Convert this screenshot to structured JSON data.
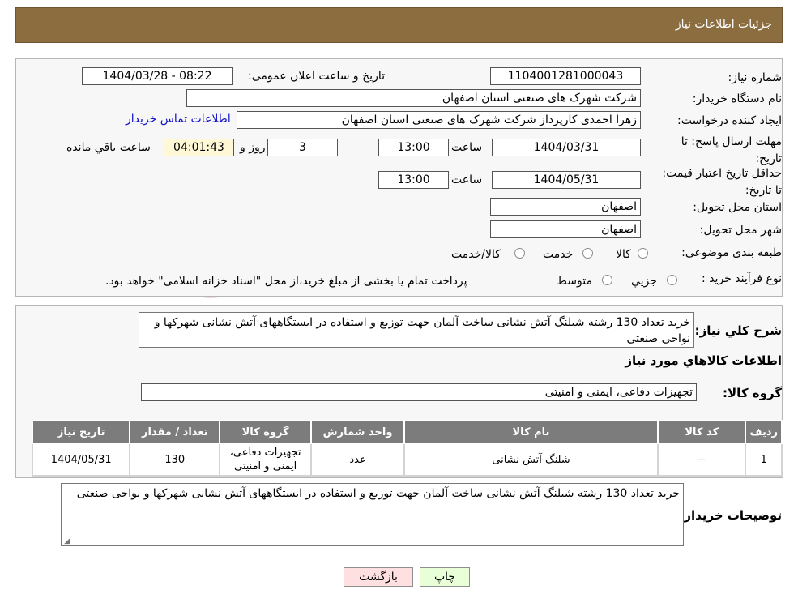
{
  "header": {
    "title": "جزئیات اطلاعات نیاز"
  },
  "form": {
    "need_number_label": "شماره نیاز:",
    "need_number": "1104001281000043",
    "announce_label": "تاریخ و ساعت اعلان عمومی:",
    "announce_value": "1404/03/28 - 08:22",
    "buyer_org_label": "نام دستگاه خریدار:",
    "buyer_org": "شرکت شهرک های صنعتی استان اصفهان",
    "creator_label": "ایجاد کننده درخواست:",
    "creator": "زهرا احمدی کارپرداز شرکت شهرک های صنعتی استان اصفهان",
    "contact_link": "اطلاعات تماس خریدار",
    "reply_deadline_label": "مهلت ارسال پاسخ: تا تاریخ:",
    "reply_date": "1404/03/31",
    "time_label": "ساعت",
    "reply_time": "13:00",
    "days": "3",
    "days_label": "روز و",
    "remaining_time": "04:01:43",
    "remaining_label": "ساعت باقي مانده",
    "validity_label": "حداقل تاریخ اعتبار قیمت: تا تاریخ:",
    "validity_date": "1404/05/31",
    "validity_time": "13:00",
    "province_label": "استان محل تحویل:",
    "province": "اصفهان",
    "city_label": "شهر محل تحویل:",
    "city": "اصفهان",
    "category_label": "طبقه بندی موضوعی:",
    "category_options": [
      "کالا",
      "خدمت",
      "کالا/خدمت"
    ],
    "process_label": "نوع فرآیند خرید :",
    "process_options": [
      "جزیي",
      "متوسط"
    ],
    "process_note": "پرداخت تمام یا بخشی از مبلغ خرید،از محل \"اسناد خزانه اسلامی\" خواهد بود."
  },
  "summary": {
    "label": "شرح کلي نياز:",
    "text": "خرید تعداد 130 رشته شیلنگ آتش نشانی ساخت آلمان جهت توزیع و استفاده در ایستگاههای آتش نشانی شهرکها و نواحی صنعتی",
    "goods_info_title": "اطلاعات کالاهاي مورد نياز",
    "goods_group_label": "گروه کالا:",
    "goods_group": "تجهیزات دفاعی، ایمنی و امنیتی"
  },
  "table": {
    "headers": [
      "رديف",
      "کد کالا",
      "نام کالا",
      "واحد شمارش",
      "گروه کالا",
      "تعداد / مقدار",
      "تاريخ نياز"
    ],
    "rows": [
      [
        "1",
        "--",
        "شلنگ آتش نشانی",
        "عدد",
        "تجهیزات دفاعی، ایمنی و امنیتی",
        "130",
        "1404/05/31"
      ]
    ]
  },
  "buyer_notes": {
    "label": "توضيحات خريدار:",
    "text": "خرید تعداد 130 رشته شیلنگ آتش نشانی ساخت آلمان جهت توزیع و استفاده در ایستگاههای آتش نشانی شهرکها و نواحی صنعتی"
  },
  "buttons": {
    "print": "چاپ",
    "back": "بازگشت"
  },
  "colors": {
    "header": "#8b6d3f",
    "table_header": "#7c7c7c",
    "back_button": "#ffe0e0",
    "print_button": "#e8ffd8"
  }
}
